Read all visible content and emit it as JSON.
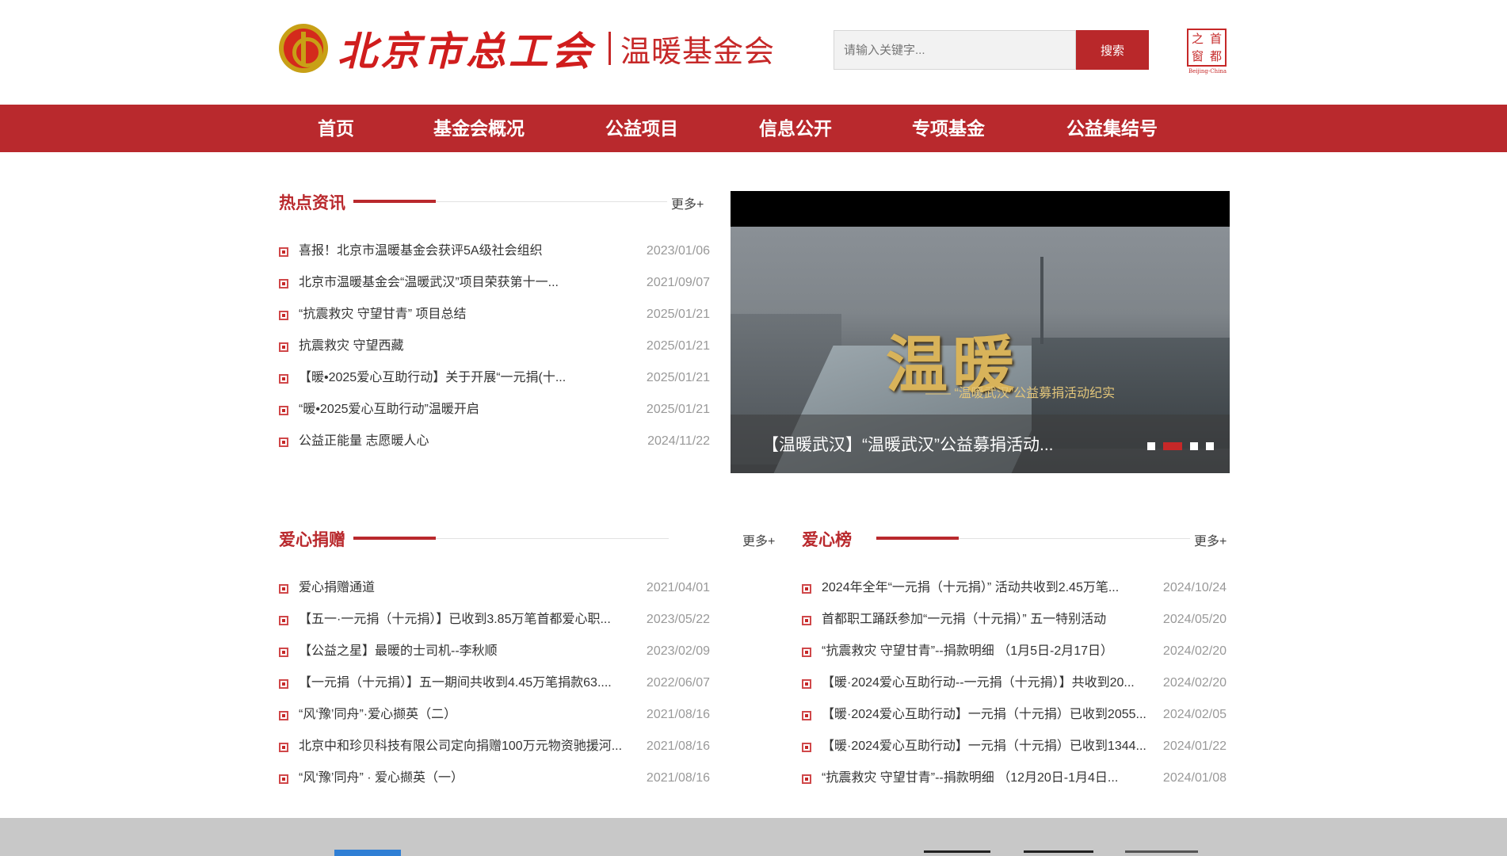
{
  "header": {
    "logo_name": "北京市总工会",
    "logo_subtitle": "温暖基金会",
    "search_placeholder": "请输入关键字...",
    "search_button": "搜索",
    "stamp_chars": [
      "之",
      "首",
      "窗",
      "都"
    ],
    "stamp_caption": "Beijing-China"
  },
  "nav": {
    "items": [
      "首页",
      "基金会概况",
      "公益项目",
      "信息公开",
      "专项基金",
      "公益集结号"
    ]
  },
  "hot_news": {
    "title": "热点资讯",
    "more": "更多+",
    "items": [
      {
        "title": "喜报！北京市温暖基金会获评5A级社会组织",
        "date": "2023/01/06"
      },
      {
        "title": "北京市温暖基金会“温暖武汉”项目荣获第十一...",
        "date": "2021/09/07"
      },
      {
        "title": "“抗震救灾 守望甘青” 项目总结",
        "date": "2025/01/21"
      },
      {
        "title": "抗震救灾 守望西藏",
        "date": "2025/01/21"
      },
      {
        "title": "【暖•2025爱心互助行动】关于开展“一元捐(十...",
        "date": "2025/01/21"
      },
      {
        "title": "“暖•2025爱心互助行动”温暖开启",
        "date": "2025/01/21"
      },
      {
        "title": "公益正能量 志愿暖人心",
        "date": "2024/11/22"
      }
    ]
  },
  "slider": {
    "image_title": "温暖",
    "image_subtitle": "—— “温暖武汉”公益募捐活动纪实",
    "caption": "【温暖武汉】“温暖武汉”公益募捐活动...",
    "slide_count": 4,
    "active_slide": 2
  },
  "donations": {
    "title": "爱心捐赠",
    "more": "更多+",
    "items": [
      {
        "title": "爱心捐赠通道",
        "date": "2021/04/01"
      },
      {
        "title": "【五一·一元捐（十元捐）】已收到3.85万笔首都爱心职...",
        "date": "2023/05/22"
      },
      {
        "title": "【公益之星】最暖的士司机--李秋顺",
        "date": "2023/02/09"
      },
      {
        "title": "【一元捐（十元捐）】五一期间共收到4.45万笔捐款63....",
        "date": "2022/06/07"
      },
      {
        "title": "“风‘豫’同舟”·爱心撷英（二）",
        "date": "2021/08/16"
      },
      {
        "title": "北京中和珍贝科技有限公司定向捐赠100万元物资驰援河...",
        "date": "2021/08/16"
      },
      {
        "title": "“风‘豫’同舟” · 爱心撷英（一）",
        "date": "2021/08/16"
      }
    ]
  },
  "love_board": {
    "title": "爱心榜",
    "more": "更多+",
    "items": [
      {
        "title": "2024年全年“一元捐（十元捐）” 活动共收到2.45万笔...",
        "date": "2024/10/24"
      },
      {
        "title": "首都职工踊跃参加“一元捐（十元捐）” 五一特别活动",
        "date": "2024/05/20"
      },
      {
        "title": "“抗震救灾 守望甘青”--捐款明细 （1月5日-2月17日）",
        "date": "2024/02/20"
      },
      {
        "title": "【暖·2024爱心互助行动--一元捐（十元捐）】共收到20...",
        "date": "2024/02/20"
      },
      {
        "title": "【暖·2024爱心互助行动】一元捐（十元捐）已收到2055...",
        "date": "2024/02/05"
      },
      {
        "title": "【暖·2024爱心互助行动】一元捐（十元捐）已收到1344...",
        "date": "2024/01/22"
      },
      {
        "title": "“抗震救灾 守望甘青”--捐款明细 （12月20日-1月4日...",
        "date": "2024/01/08"
      }
    ]
  },
  "colors": {
    "brand_red": "#b9292d",
    "footer_gray": "#c8c8c8",
    "footer_blue": "#2f7fd5"
  }
}
